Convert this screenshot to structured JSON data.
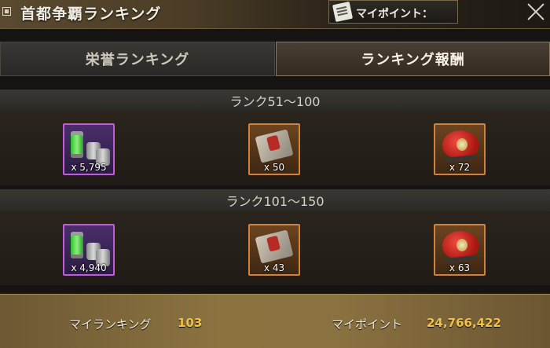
{
  "header": {
    "title": "首都争覇ランキング",
    "mypoint_label": "マイポイント："
  },
  "tabs": [
    {
      "label": "栄誉ランキング",
      "active": false
    },
    {
      "label": "ランキング報酬",
      "active": true
    }
  ],
  "sections": [
    {
      "title": "ランク51～100",
      "items": [
        {
          "icon": "fuel-canister-icon",
          "count": "x 5,795",
          "rarity": "purple"
        },
        {
          "icon": "skill-manual-icon",
          "count": "x 50",
          "rarity": "orange"
        },
        {
          "icon": "red-beret-icon",
          "count": "x 72",
          "rarity": "orange"
        }
      ]
    },
    {
      "title": "ランク101～150",
      "items": [
        {
          "icon": "fuel-canister-icon",
          "count": "x 4,940",
          "rarity": "purple"
        },
        {
          "icon": "skill-manual-icon",
          "count": "x 43",
          "rarity": "orange"
        },
        {
          "icon": "red-beret-icon",
          "count": "x 63",
          "rarity": "orange"
        }
      ]
    }
  ],
  "footer": {
    "my_ranking_label": "マイランキング",
    "my_ranking_value": "103",
    "my_points_label": "マイポイント",
    "my_points_value": "24,766,422"
  },
  "colors": {
    "purple_rarity": "#c35ad9",
    "orange_rarity": "#d0813a",
    "footer_value": "#f2c24a"
  }
}
